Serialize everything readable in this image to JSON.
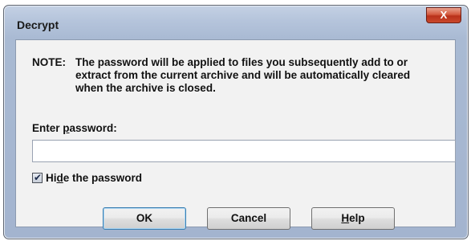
{
  "window": {
    "title": "Decrypt",
    "close_label": "X"
  },
  "note": {
    "label": "NOTE:",
    "text": "The password will be applied to files you subsequently add to or extract from the current archive and will be automatically cleared when the archive is closed."
  },
  "password": {
    "label_prefix": "Enter ",
    "label_mnemonic": "p",
    "label_suffix": "assword:",
    "value": "",
    "placeholder": ""
  },
  "hide_password": {
    "checked": true,
    "label_prefix": "Hi",
    "label_mnemonic": "d",
    "label_suffix": "e the password"
  },
  "buttons": {
    "ok": "OK",
    "cancel": "Cancel",
    "help_mnemonic": "H",
    "help_suffix": "elp"
  },
  "icons": {
    "close": "close-icon",
    "checkbox": "checkmark-icon"
  },
  "colors": {
    "title_bar": "#b6c5dc",
    "close_button": "#c9492c",
    "client_background": "#f2f2f2",
    "default_button_border": "#3c7fb1"
  }
}
